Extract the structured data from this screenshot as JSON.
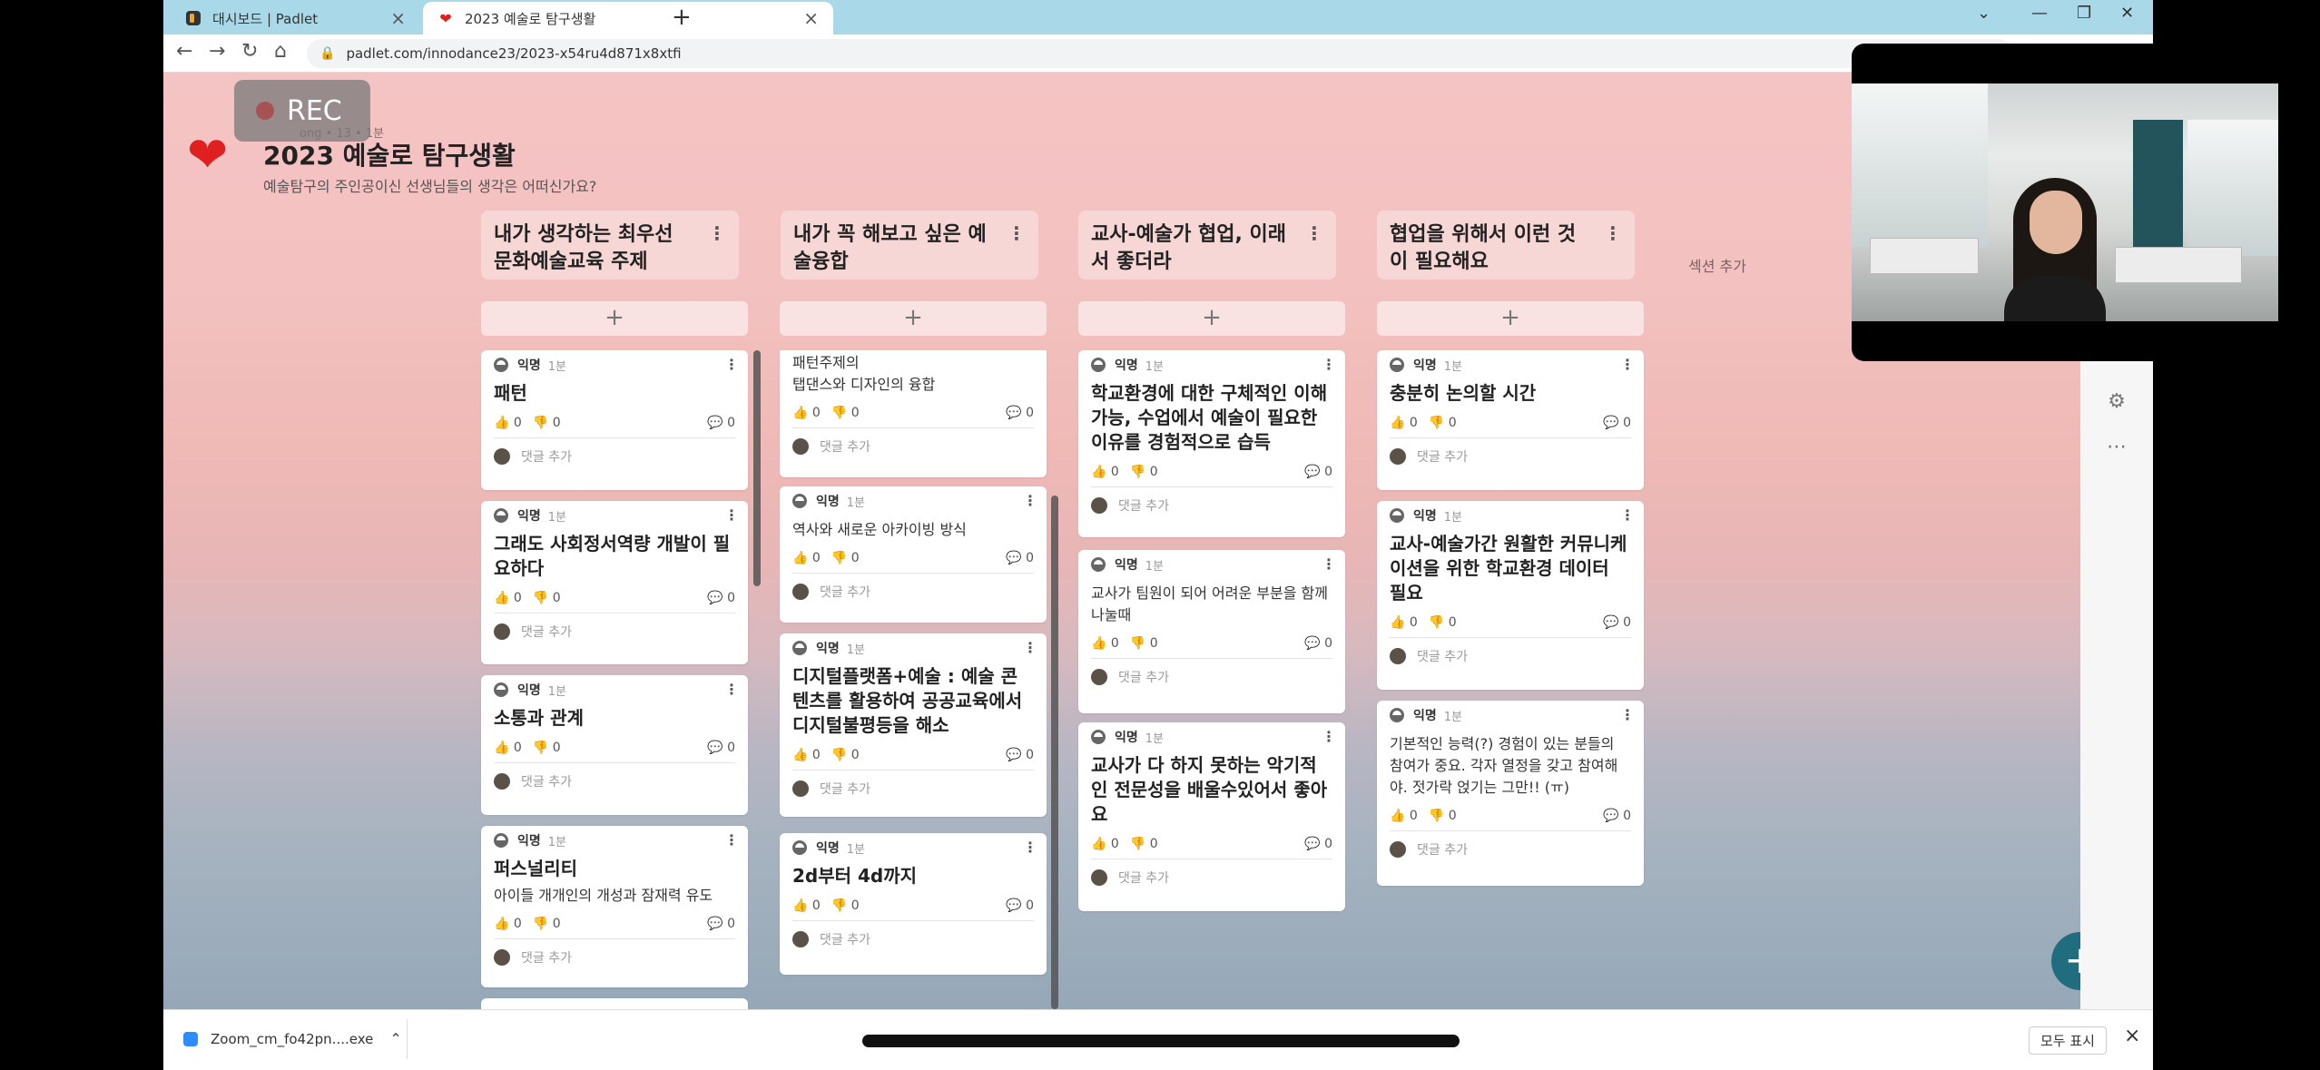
{
  "browser": {
    "tabs": [
      {
        "title": "대시보드 | Padlet",
        "favicon": "padlet-icon"
      },
      {
        "title": "2023 예술로 탐구생활",
        "favicon": "heart-icon",
        "active": true
      }
    ],
    "new_tab": "+",
    "url": "padlet.com/innodance23/2023-x54ru4d871x8xtfi"
  },
  "rec": {
    "label": "REC"
  },
  "padlet": {
    "meta": "ong • 13 • 1분",
    "title": "2023 예술로 탐구생활",
    "subtitle": "예술탐구의 주인공이신 선생님들의 생각은 어떠신가요?",
    "section_add": "섹션 추가",
    "columns": [
      {
        "title_line1": "내가 생각하는 최우선",
        "title_line2": "문화예술교육 주제",
        "cards": [
          {
            "author": "익명",
            "age": "1분",
            "title": "패턴",
            "body": "",
            "likes": "0",
            "dislikes": "0",
            "comments": "0",
            "add_comment": "댓글 추가"
          },
          {
            "author": "익명",
            "age": "1분",
            "title": "그래도 사회정서역량 개발이 필요하다",
            "body": "",
            "likes": "0",
            "dislikes": "0",
            "comments": "0",
            "add_comment": "댓글 추가"
          },
          {
            "author": "익명",
            "age": "1분",
            "title": "소통과 관계",
            "body": "",
            "likes": "0",
            "dislikes": "0",
            "comments": "0",
            "add_comment": "댓글 추가"
          },
          {
            "author": "익명",
            "age": "1분",
            "title": "퍼스널리티",
            "body": "아이들 개개인의 개성과 잠재력 유도",
            "likes": "0",
            "dislikes": "0",
            "comments": "0",
            "add_comment": "댓글 추가"
          }
        ]
      },
      {
        "title_line1": "내가 꼭 해보고 싶은 예",
        "title_line2": "술융합",
        "cards": [
          {
            "author": "",
            "age": "",
            "title": "",
            "body": "패턴주제의\n탭댄스와 디자인의 융합",
            "likes": "0",
            "dislikes": "0",
            "comments": "0",
            "add_comment": "댓글 추가"
          },
          {
            "author": "익명",
            "age": "1분",
            "title": "",
            "body": "역사와 새로운 아카이빙 방식",
            "likes": "0",
            "dislikes": "0",
            "comments": "0",
            "add_comment": "댓글 추가"
          },
          {
            "author": "익명",
            "age": "1분",
            "title": "디지털플랫폼+예술 : 예술 콘텐츠를 활용하여 공공교육에서 디지털불평등을 해소",
            "body": "",
            "likes": "0",
            "dislikes": "0",
            "comments": "0",
            "add_comment": "댓글 추가"
          },
          {
            "author": "익명",
            "age": "1분",
            "title": "2d부터 4d까지",
            "body": "",
            "likes": "0",
            "dislikes": "0",
            "comments": "0",
            "add_comment": "댓글 추가"
          }
        ]
      },
      {
        "title_line1": "교사-예술가 협업, 이래",
        "title_line2": "서 좋더라",
        "cards": [
          {
            "author": "익명",
            "age": "1분",
            "title": "학교환경에 대한 구체적인 이해 가능, 수업에서 예술이 필요한 이유를 경험적으로 습득",
            "body": "",
            "likes": "0",
            "dislikes": "0",
            "comments": "0",
            "add_comment": "댓글 추가"
          },
          {
            "author": "익명",
            "age": "1분",
            "title": "",
            "body": "교사가 팀원이 되어 어려운 부분을 함께 나눌때",
            "likes": "0",
            "dislikes": "0",
            "comments": "0",
            "add_comment": "댓글 추가"
          },
          {
            "author": "익명",
            "age": "1분",
            "title": "교사가 다 하지 못하는 악기적인 전문성을 배울수있어서 좋아요",
            "body": "",
            "likes": "0",
            "dislikes": "0",
            "comments": "0",
            "add_comment": "댓글 추가"
          }
        ]
      },
      {
        "title_line1": "협업을 위해서 이런 것",
        "title_line2": "이 필요해요",
        "cards": [
          {
            "author": "익명",
            "age": "1분",
            "title": "충분히 논의할 시간",
            "body": "",
            "likes": "0",
            "dislikes": "0",
            "comments": "0",
            "add_comment": "댓글 추가"
          },
          {
            "author": "익명",
            "age": "1분",
            "title": "교사-예술가간 원활한 커뮤니케이션을 위한 학교환경 데이터 필요",
            "body": "",
            "likes": "0",
            "dislikes": "0",
            "comments": "0",
            "add_comment": "댓글 추가"
          },
          {
            "author": "익명",
            "age": "1분",
            "title": "",
            "body": "기본적인 능력(?) 경험이 있는 분들의 참여가 중요. 각자 열정을 갖고 참여해야. 젓가락 얹기는 그만!! (ㅠ)",
            "likes": "0",
            "dislikes": "0",
            "comments": "0",
            "add_comment": "댓글 추가"
          }
        ]
      }
    ]
  },
  "downloads": {
    "file": "Zoom_cm_fo42pn....exe",
    "show_all": "모두 표시"
  },
  "colors": {
    "tabbar": "#a9d9e9",
    "fab": "#206d80",
    "heart": "#e02020"
  }
}
